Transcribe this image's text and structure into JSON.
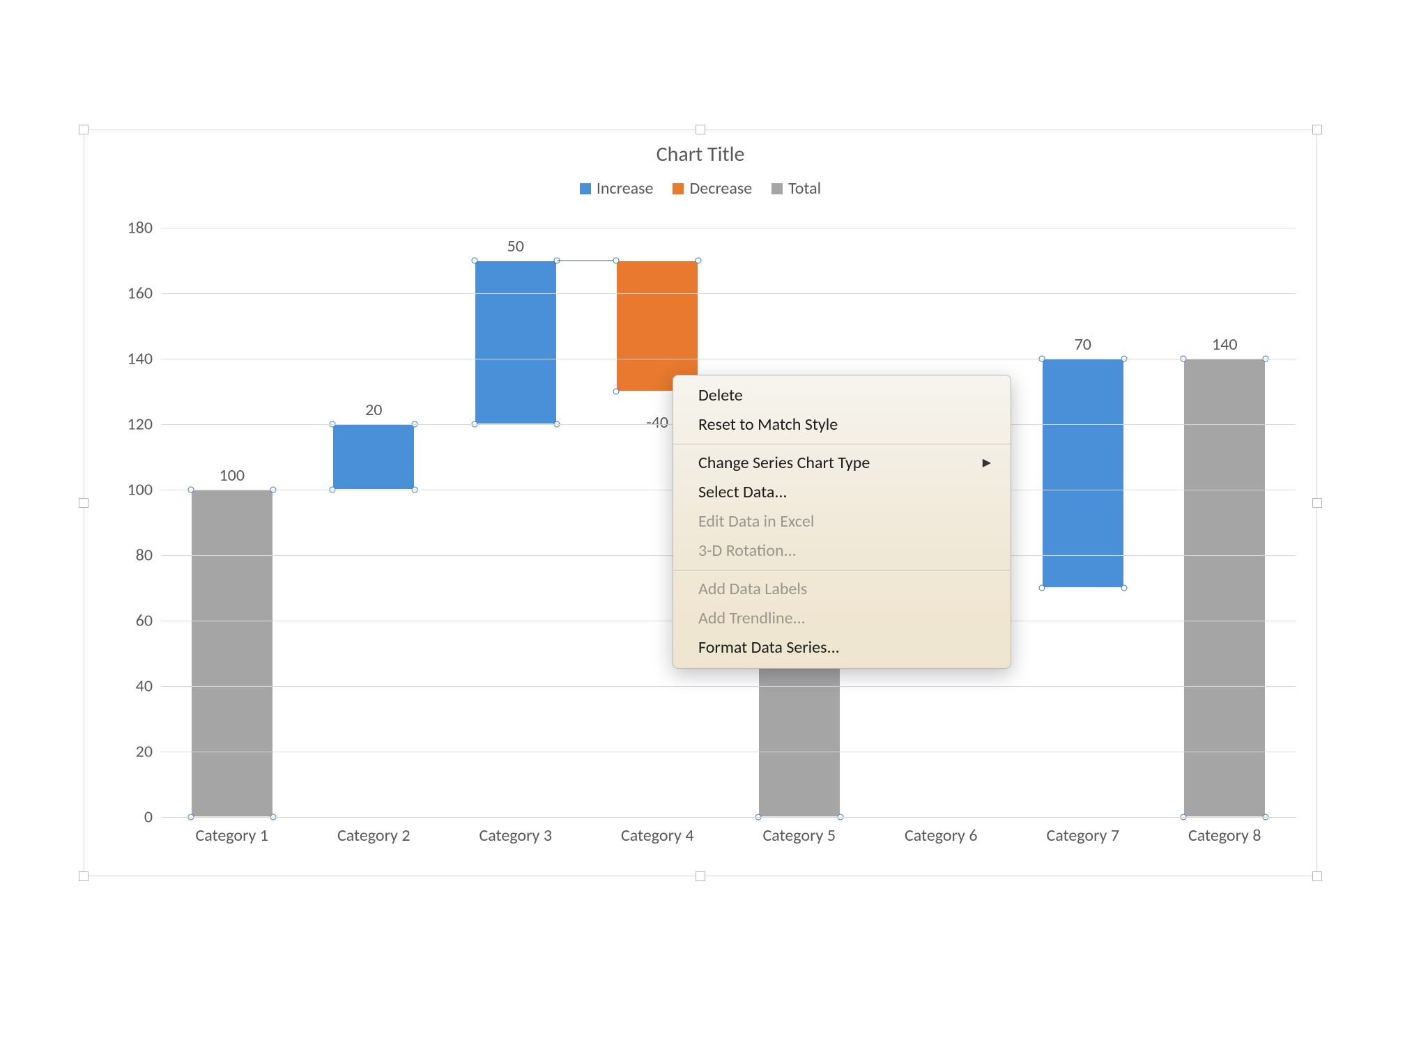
{
  "chart_data": {
    "type": "waterfall",
    "title": "Chart Title",
    "legend": [
      {
        "name": "Increase",
        "color": "#4a90d9"
      },
      {
        "name": "Decrease",
        "color": "#e8792e"
      },
      {
        "name": "Total",
        "color": "#a5a5a5"
      }
    ],
    "categories": [
      "Category 1",
      "Category 2",
      "Category 3",
      "Category 4",
      "Category 5",
      "Category 6",
      "Category 7",
      "Category 8"
    ],
    "data": [
      {
        "label": "100",
        "value": 100,
        "kind": "total",
        "start": 0,
        "end": 100
      },
      {
        "label": "20",
        "value": 20,
        "kind": "increase",
        "start": 100,
        "end": 120
      },
      {
        "label": "50",
        "value": 50,
        "kind": "increase",
        "start": 120,
        "end": 170
      },
      {
        "label": "-40",
        "value": -40,
        "kind": "decrease",
        "start": 170,
        "end": 130
      },
      {
        "label": "",
        "value": null,
        "kind": "total",
        "start": 0,
        "end": null
      },
      {
        "label": "",
        "value": null,
        "kind": "hidden",
        "start": null,
        "end": null
      },
      {
        "label": "70",
        "value": 70,
        "kind": "increase",
        "start": 70,
        "end": 140
      },
      {
        "label": "140",
        "value": 140,
        "kind": "total",
        "start": 0,
        "end": 140
      }
    ],
    "y_axis": {
      "min": 0,
      "max": 180,
      "step": 20,
      "ticks": [
        0,
        20,
        40,
        60,
        80,
        100,
        120,
        140,
        160,
        180
      ]
    },
    "xlabel": "",
    "ylabel": "",
    "grid": true,
    "legend_position": "top"
  },
  "context_menu": {
    "items": [
      {
        "label": "Delete",
        "enabled": true,
        "submenu": false
      },
      {
        "label": "Reset to Match Style",
        "enabled": true,
        "submenu": false
      },
      {
        "separator": true
      },
      {
        "label": "Change Series Chart Type",
        "enabled": true,
        "submenu": true
      },
      {
        "label": "Select Data...",
        "enabled": true,
        "submenu": false
      },
      {
        "label": "Edit Data in Excel",
        "enabled": false,
        "submenu": false
      },
      {
        "label": "3-D Rotation...",
        "enabled": false,
        "submenu": false
      },
      {
        "separator": true
      },
      {
        "label": "Add Data Labels",
        "enabled": false,
        "submenu": false
      },
      {
        "label": "Add Trendline...",
        "enabled": false,
        "submenu": false
      },
      {
        "label": "Format Data Series...",
        "enabled": true,
        "submenu": false
      }
    ]
  },
  "colors": {
    "increase": "#4a90d9",
    "decrease": "#e8792e",
    "total": "#a5a5a5"
  }
}
